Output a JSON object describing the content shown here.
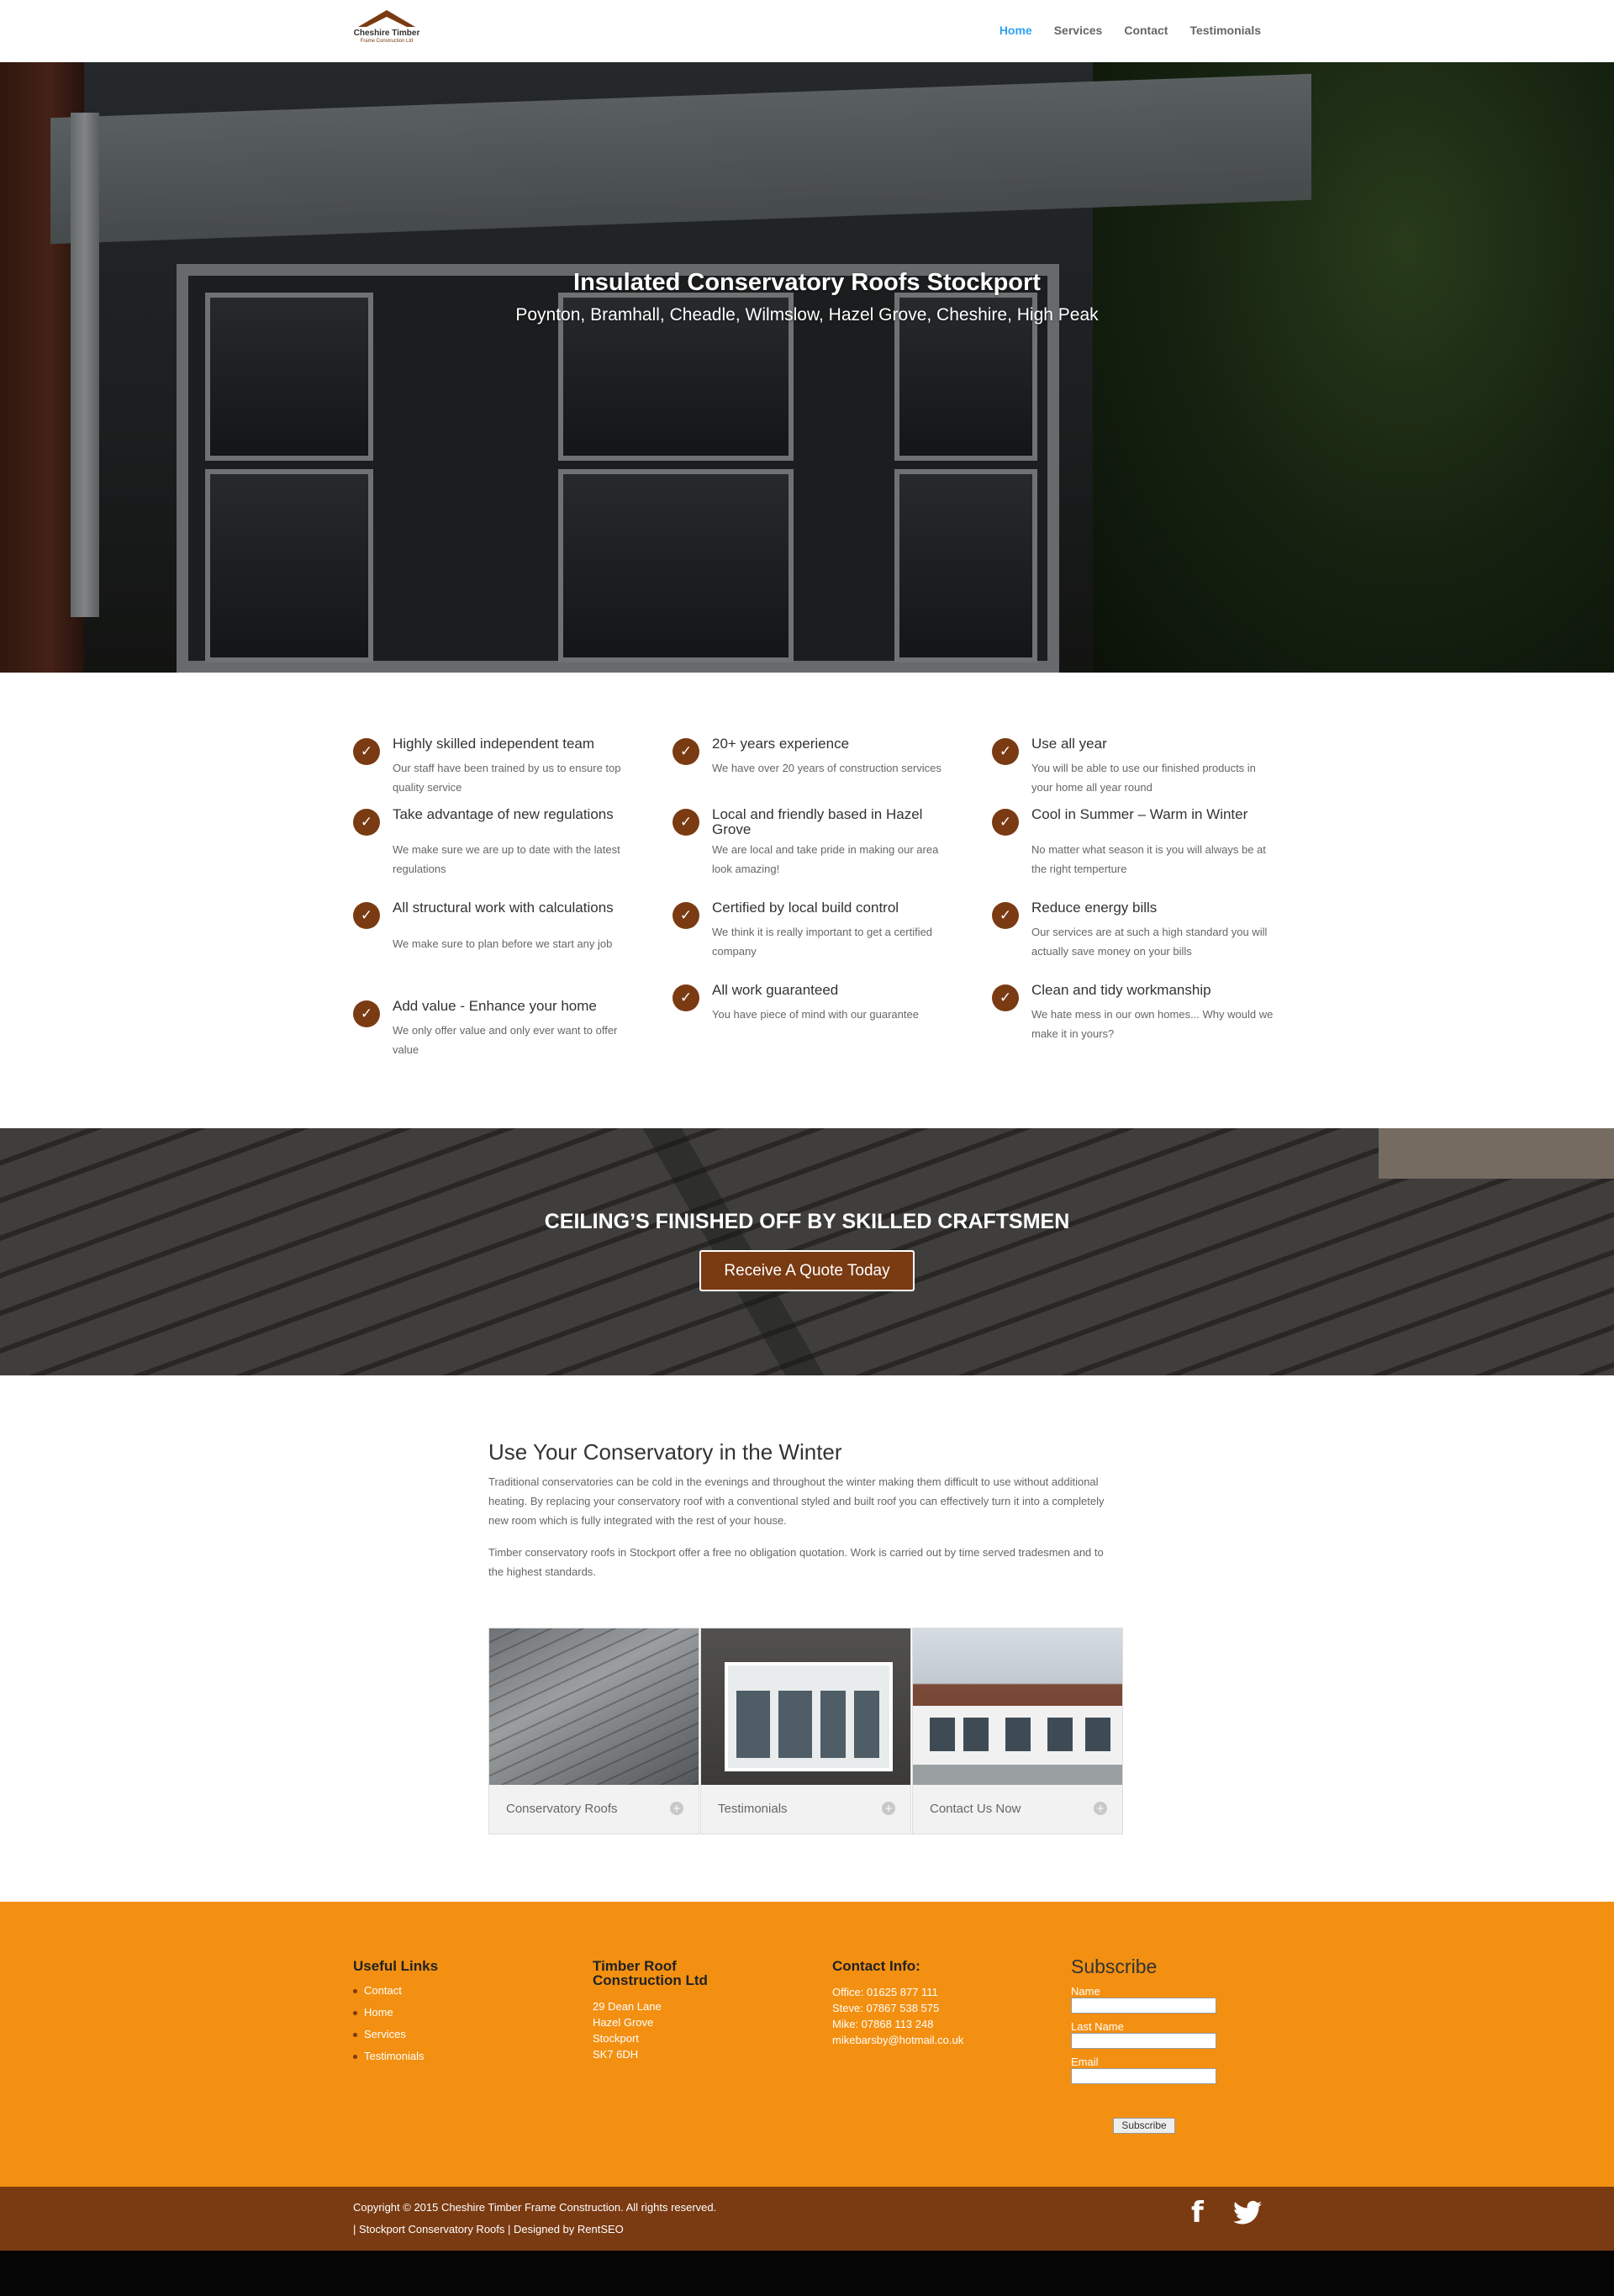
{
  "header": {
    "logo_text": "Cheshire Timber",
    "logo_sub": "Frame Construction Ltd",
    "nav": [
      "Home",
      "Services",
      "Contact",
      "Testimonials"
    ]
  },
  "hero": {
    "title": "Insulated Conservatory Roofs Stockport",
    "subtitle": "Poynton, Bramhall, Cheadle, Wilmslow, Hazel Grove, Cheshire, High Peak"
  },
  "features": [
    {
      "title": "Highly skilled independent team",
      "desc": "Our staff have been trained by us to ensure top quality service"
    },
    {
      "title": "20+ years experience",
      "desc": "We have over 20 years of construction services"
    },
    {
      "title": "Use all year",
      "desc": "You will be able to use our finished products in your home all year round"
    },
    {
      "title": "Take advantage of new regulations",
      "desc": "We make sure we are up to date with the latest regulations"
    },
    {
      "title": "Local and friendly based in Hazel Grove",
      "desc": "We are local and take pride in making our area look amazing!"
    },
    {
      "title": "Cool in Summer – Warm in Winter",
      "desc": "No matter what season it is you will always be at the right temperture"
    },
    {
      "title": "All structural work with calculations",
      "desc": "We make sure to plan before we start any job"
    },
    {
      "title": "Certified by local build control",
      "desc": "We think it is really important to get a certified company"
    },
    {
      "title": "Reduce energy bills",
      "desc": "Our services are at such a high standard you will actually save money on your bills"
    },
    {
      "title": "Add value - Enhance your home",
      "desc": "We only offer value and only ever want to offer value"
    },
    {
      "title": "All work guaranteed",
      "desc": "You have piece of mind with our guarantee"
    },
    {
      "title": "Clean and tidy workmanship",
      "desc": "We hate mess in our own homes... Why would we make it in yours?"
    }
  ],
  "banner": {
    "title": "CEILING’S FINISHED OFF BY SKILLED CRAFTSMEN",
    "button": "Receive A Quote Today"
  },
  "content": {
    "title": "Use Your Conservatory in the Winter",
    "p1": "Traditional conservatories can be cold in the evenings and throughout the winter making them difficult to use without additional heating. By replacing your conservatory roof with a conventional styled and built roof you can effectively turn it into a completely new room which is fully integrated with the rest of your house.",
    "p2": "Timber conservatory roofs in Stockport offer a free no obligation quotation. Work is carried out by time served tradesmen and to the highest standards."
  },
  "cards": [
    "Conservatory Roofs",
    "Testimonials",
    "Contact Us Now"
  ],
  "footer": {
    "links_title": "Useful Links",
    "links": [
      "Contact",
      "Home",
      "Services",
      "Testimonials"
    ],
    "company_title": "Timber Roof Construction Ltd",
    "address": [
      "29 Dean Lane",
      "Hazel Grove",
      "Stockport",
      "SK7 6DH"
    ],
    "contact_title": "Contact Info:",
    "contact": [
      "Office: 01625 877 111",
      "Steve: 07867 538 575",
      "Mike: 07868 113 248",
      "mikebarsby@hotmail.co.uk"
    ],
    "subscribe_title": "Subscribe",
    "fields": [
      "Name",
      "Last Name",
      "Email"
    ],
    "subscribe_button": "Subscribe"
  },
  "bottom": {
    "copyright": "Copyright © 2015 Cheshire Timber Frame Construction. All rights reserved.",
    "credits": "| Stockport Conservatory Roofs | Designed by RentSEO"
  },
  "icons": {
    "check": "check-icon",
    "plus": "plus-icon",
    "facebook": "facebook-icon",
    "twitter": "twitter-icon"
  },
  "colors": {
    "brand_brown": "#7a3a12",
    "footer_orange": "#f39012",
    "nav_active": "#2ea3f2"
  }
}
